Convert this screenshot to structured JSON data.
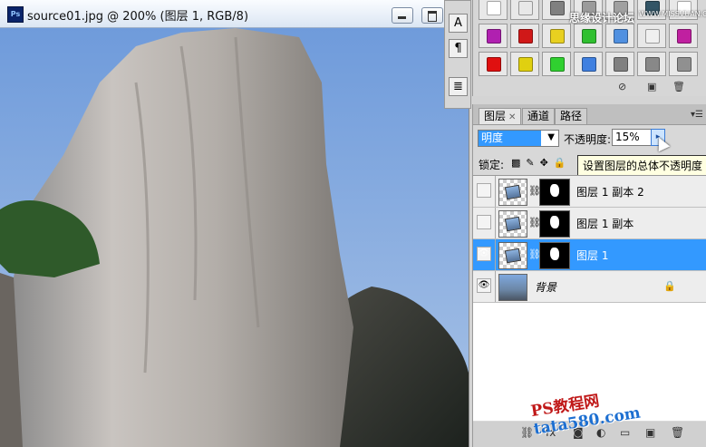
{
  "document": {
    "title": "source01.jpg @ 200% (图层 1, RGB/8)",
    "app_icon": "Ps"
  },
  "side_tools": [
    "A",
    "¶",
    "≣"
  ],
  "styles_panel": {
    "swatch_colors": [
      [
        "#ffffff",
        "#e8e8e8",
        "#808080",
        "#9b9b9b",
        "#a0a0a0",
        "#335566",
        "#ffffff"
      ],
      [
        "#b020b0",
        "#d01818",
        "#e8d020",
        "#30c030",
        "#5090e0",
        "#f0f0f0",
        "#c020a0"
      ],
      [
        "#e01010",
        "#e0d010",
        "#30d030",
        "#4080e0",
        "#808080",
        "#888888",
        "#909090"
      ]
    ],
    "watermark_text": "思缘设计论坛",
    "watermark_url": "WWW.MISSVUAN.COM"
  },
  "layers_panel": {
    "tabs": [
      {
        "label": "图层",
        "active": true,
        "closable": true
      },
      {
        "label": "通道",
        "active": false
      },
      {
        "label": "路径",
        "active": false
      }
    ],
    "blend_mode": "明度",
    "opacity_label": "不透明度:",
    "opacity_value": "15%",
    "tooltip": "设置图层的总体不透明度",
    "lock_label": "锁定:",
    "layers": [
      {
        "name": "图层 1 副本 2",
        "visible": false,
        "selected": false,
        "has_mask": true
      },
      {
        "name": "图层 1 副本",
        "visible": false,
        "selected": false,
        "has_mask": true
      },
      {
        "name": "图层 1",
        "visible": true,
        "selected": true,
        "has_mask": true
      },
      {
        "name": "背景",
        "visible": true,
        "selected": false,
        "has_mask": false,
        "locked": true
      }
    ]
  },
  "watermark": {
    "prefix": "PS教程网",
    "site": "tata580.com"
  }
}
